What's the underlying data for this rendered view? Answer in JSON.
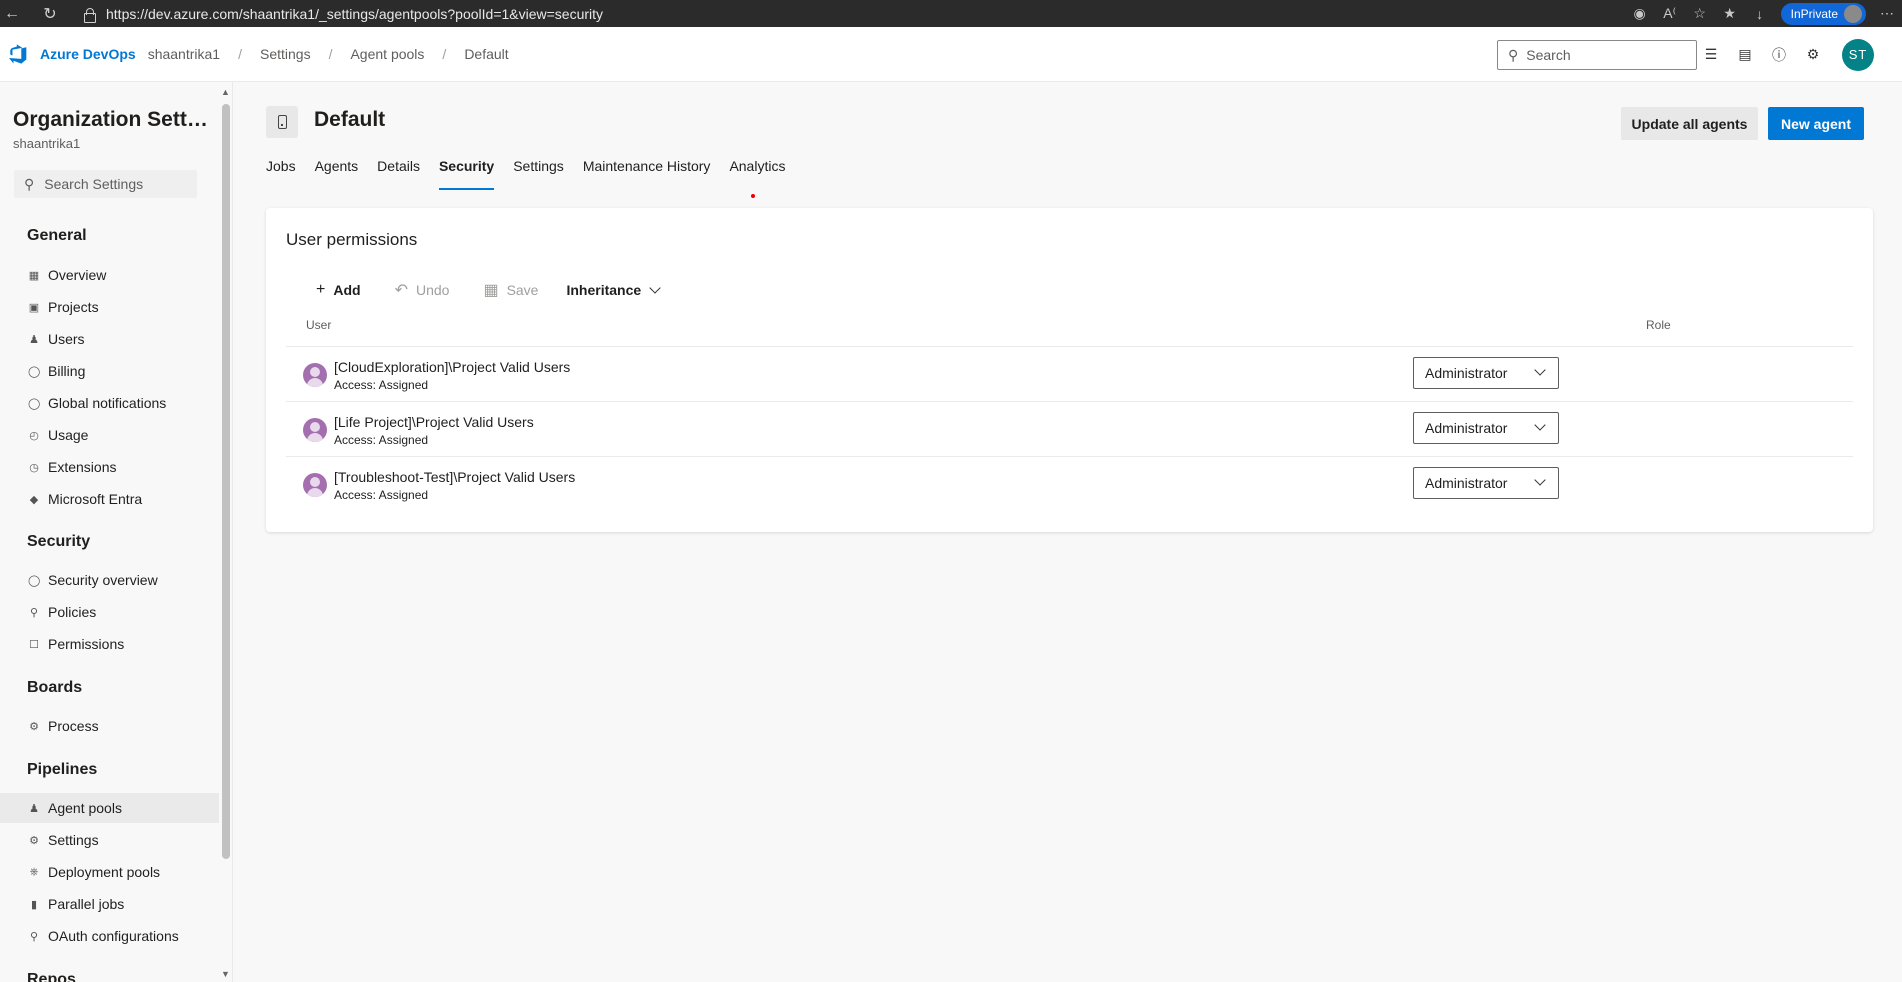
{
  "browser": {
    "url": "https://dev.azure.com/shaantrika1/_settings/agentpools?poolId=1&view=security",
    "inprivate_label": "InPrivate"
  },
  "topnav": {
    "brand": "Azure DevOps",
    "breadcrumbs": [
      "shaantrika1",
      "Settings",
      "Agent pools",
      "Default"
    ],
    "search_placeholder": "Search",
    "avatar_initials": "ST"
  },
  "sidebar": {
    "title": "Organization Settin...",
    "subtitle": "shaantrika1",
    "search_placeholder": "Search Settings",
    "sections": [
      {
        "heading": "General",
        "items": [
          {
            "label": "Overview",
            "icon": "grid-icon"
          },
          {
            "label": "Projects",
            "icon": "project-icon"
          },
          {
            "label": "Users",
            "icon": "users-icon"
          },
          {
            "label": "Billing",
            "icon": "billing-icon"
          },
          {
            "label": "Global notifications",
            "icon": "notification-icon"
          },
          {
            "label": "Usage",
            "icon": "usage-icon"
          },
          {
            "label": "Extensions",
            "icon": "extension-icon"
          },
          {
            "label": "Microsoft Entra",
            "icon": "entra-icon"
          }
        ]
      },
      {
        "heading": "Security",
        "items": [
          {
            "label": "Security overview",
            "icon": "shield-icon"
          },
          {
            "label": "Policies",
            "icon": "policy-icon"
          },
          {
            "label": "Permissions",
            "icon": "lock-icon"
          }
        ]
      },
      {
        "heading": "Boards",
        "items": [
          {
            "label": "Process",
            "icon": "process-icon"
          }
        ]
      },
      {
        "heading": "Pipelines",
        "items": [
          {
            "label": "Agent pools",
            "icon": "agent-pool-icon",
            "active": true
          },
          {
            "label": "Settings",
            "icon": "gear-icon"
          },
          {
            "label": "Deployment pools",
            "icon": "deployment-icon"
          },
          {
            "label": "Parallel jobs",
            "icon": "parallel-icon"
          },
          {
            "label": "OAuth configurations",
            "icon": "key-icon"
          }
        ]
      },
      {
        "heading": "Repos",
        "items": []
      }
    ]
  },
  "page": {
    "title": "Default",
    "update_button": "Update all agents",
    "new_agent_button": "New agent",
    "tabs": [
      "Jobs",
      "Agents",
      "Details",
      "Security",
      "Settings",
      "Maintenance History",
      "Analytics"
    ],
    "active_tab": "Security"
  },
  "permissions": {
    "title": "User permissions",
    "toolbar": {
      "add": "Add",
      "undo": "Undo",
      "save": "Save",
      "inheritance": "Inheritance"
    },
    "columns": {
      "user": "User",
      "role": "Role"
    },
    "rows": [
      {
        "name": "[CloudExploration]\\Project Valid Users",
        "access": "Access: Assigned",
        "role": "Administrator"
      },
      {
        "name": "[Life Project]\\Project Valid Users",
        "access": "Access: Assigned",
        "role": "Administrator"
      },
      {
        "name": "[Troubleshoot-Test]\\Project Valid Users",
        "access": "Access: Assigned",
        "role": "Administrator"
      }
    ]
  }
}
